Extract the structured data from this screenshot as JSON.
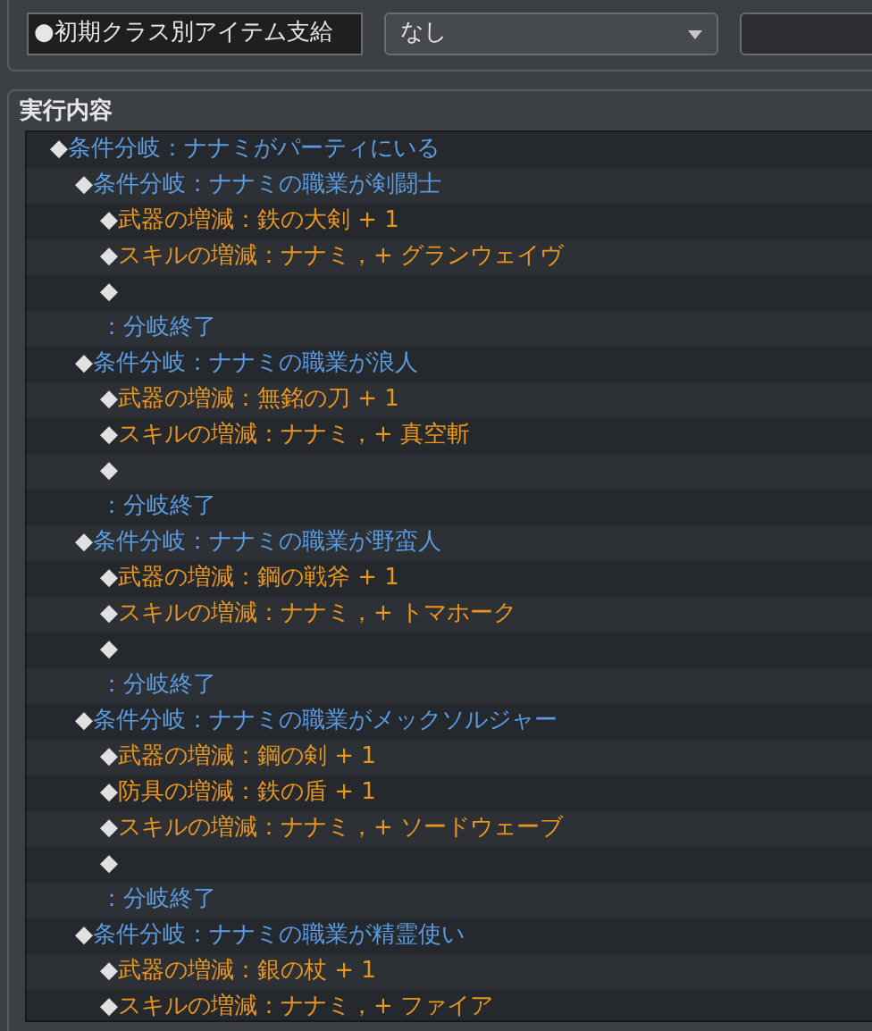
{
  "name_field": {
    "value": "●初期クラス別アイテム支給"
  },
  "trigger_dropdown": {
    "value": "なし"
  },
  "contents": {
    "title": "実行内容",
    "rows": [
      {
        "kind": "branch",
        "marker": "◆",
        "text": "条件分岐：ナナミがパーティにいる",
        "children": [
          {
            "kind": "branch",
            "marker": "◆",
            "text": "条件分岐：ナナミの職業が剣闘士",
            "children": [
              {
                "kind": "command",
                "marker": "◆",
                "text": "武器の増減：鉄の大剣 + 1"
              },
              {
                "kind": "command",
                "marker": "◆",
                "text": "スキルの増減：ナナミ，+ グランウェイヴ"
              },
              {
                "kind": "empty",
                "marker": "◆"
              }
            ]
          },
          {
            "kind": "end",
            "text": "：分岐終了"
          },
          {
            "kind": "branch",
            "marker": "◆",
            "text": "条件分岐：ナナミの職業が浪人",
            "children": [
              {
                "kind": "command",
                "marker": "◆",
                "text": "武器の増減：無銘の刀 + 1"
              },
              {
                "kind": "command",
                "marker": "◆",
                "text": "スキルの増減：ナナミ，+ 真空斬"
              },
              {
                "kind": "empty",
                "marker": "◆"
              }
            ]
          },
          {
            "kind": "end",
            "text": "：分岐終了"
          },
          {
            "kind": "branch",
            "marker": "◆",
            "text": "条件分岐：ナナミの職業が野蛮人",
            "children": [
              {
                "kind": "command",
                "marker": "◆",
                "text": "武器の増減：鋼の戦斧 + 1"
              },
              {
                "kind": "command",
                "marker": "◆",
                "text": "スキルの増減：ナナミ，+ トマホーク"
              },
              {
                "kind": "empty",
                "marker": "◆"
              }
            ]
          },
          {
            "kind": "end",
            "text": "：分岐終了"
          },
          {
            "kind": "branch",
            "marker": "◆",
            "text": "条件分岐：ナナミの職業がメックソルジャー",
            "children": [
              {
                "kind": "command",
                "marker": "◆",
                "text": "武器の増減：鋼の剣 + 1"
              },
              {
                "kind": "command",
                "marker": "◆",
                "text": "防具の増減：鉄の盾 + 1"
              },
              {
                "kind": "command",
                "marker": "◆",
                "text": "スキルの増減：ナナミ，+ ソードウェーブ"
              },
              {
                "kind": "empty",
                "marker": "◆"
              }
            ]
          },
          {
            "kind": "end",
            "text": "：分岐終了"
          },
          {
            "kind": "branch",
            "marker": "◆",
            "text": "条件分岐：ナナミの職業が精霊使い",
            "children": [
              {
                "kind": "command",
                "marker": "◆",
                "text": "武器の増減：銀の杖 + 1"
              },
              {
                "kind": "command",
                "marker": "◆",
                "text": "スキルの増減：ナナミ，+ ファイア"
              }
            ]
          }
        ]
      }
    ]
  }
}
